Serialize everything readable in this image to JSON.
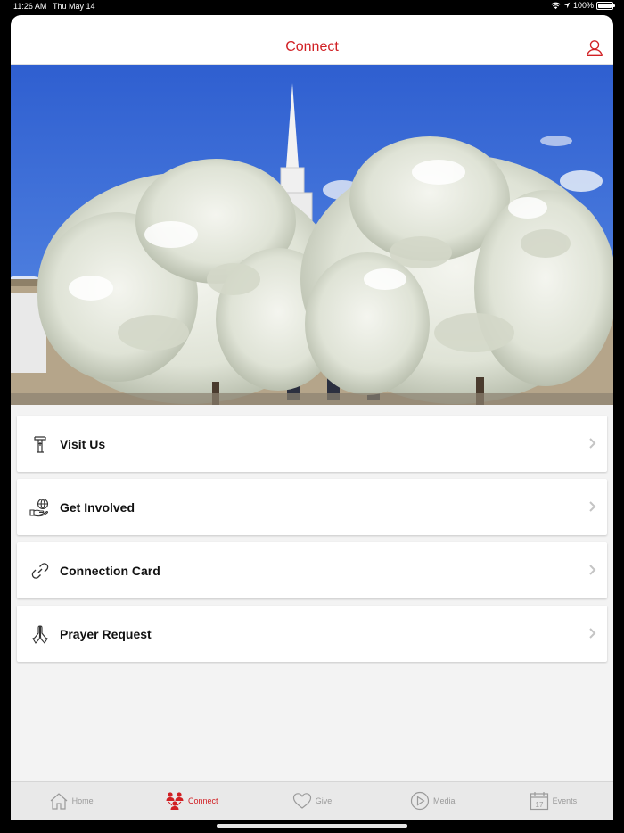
{
  "status_bar": {
    "time": "11:26 AM",
    "date": "Thu May 14",
    "battery_text": "100%"
  },
  "nav": {
    "title": "Connect",
    "profile_icon": "person-icon"
  },
  "hero": {
    "description_icon": "church-photo"
  },
  "menu": {
    "items": [
      {
        "label": "Visit Us",
        "icon": "church-icon"
      },
      {
        "label": "Get Involved",
        "icon": "hand-globe-icon"
      },
      {
        "label": "Connection Card",
        "icon": "link-icon"
      },
      {
        "label": "Prayer Request",
        "icon": "praying-hands-icon"
      }
    ]
  },
  "tabs": [
    {
      "label": "Home",
      "icon": "home-icon",
      "active": false
    },
    {
      "label": "Connect",
      "icon": "people-icon",
      "active": true
    },
    {
      "label": "Give",
      "icon": "heart-icon",
      "active": false
    },
    {
      "label": "Media",
      "icon": "play-icon",
      "active": false
    },
    {
      "label": "Events",
      "icon": "calendar-icon",
      "active": false,
      "calendar_day": "17"
    }
  ],
  "colors": {
    "accent": "#d12024",
    "inactive": "#9a9a9a"
  }
}
